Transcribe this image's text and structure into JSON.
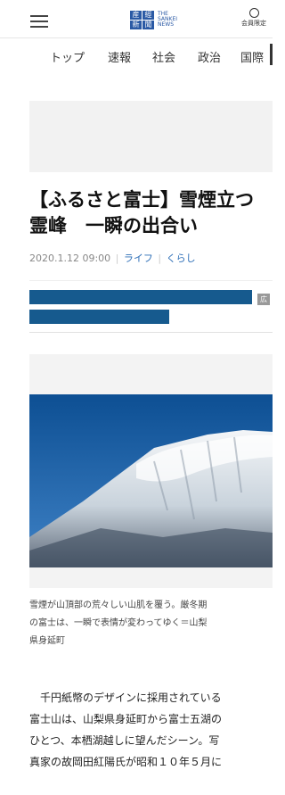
{
  "header": {
    "logo_kanji": [
      "産",
      "經",
      "新",
      "聞"
    ],
    "logo_english": [
      "THE",
      "SANKEI",
      "NEWS"
    ],
    "member_label": "会員限定"
  },
  "nav": {
    "items": [
      "トップ",
      "速報",
      "社会",
      "政治",
      "国際"
    ]
  },
  "article": {
    "title_line1": "【ふるさと富士】雪煙立つ",
    "title_line2": "霊峰　一瞬の出合い",
    "date": "2020.1.12 09:00",
    "category1": "ライフ",
    "category2": "くらし",
    "ad_badge": "広",
    "caption_lines": [
      "雪煙が山頂部の荒々しい山肌を覆う。厳冬期",
      "の富士は、一瞬で表情が変わってゆく＝山梨",
      "県身延町"
    ],
    "body_lines": [
      "　千円紙幣のデザインに採用されている",
      "富士山は、山梨県身延町から富士五湖の",
      "ひとつ、本栖湖越しに望んだシーン。写",
      "真家の故岡田紅陽氏が昭和１０年５月に"
    ]
  },
  "colors": {
    "brand_blue": "#2b5aa5",
    "share_bar": "#165a8e",
    "link": "#2e6fb7"
  }
}
